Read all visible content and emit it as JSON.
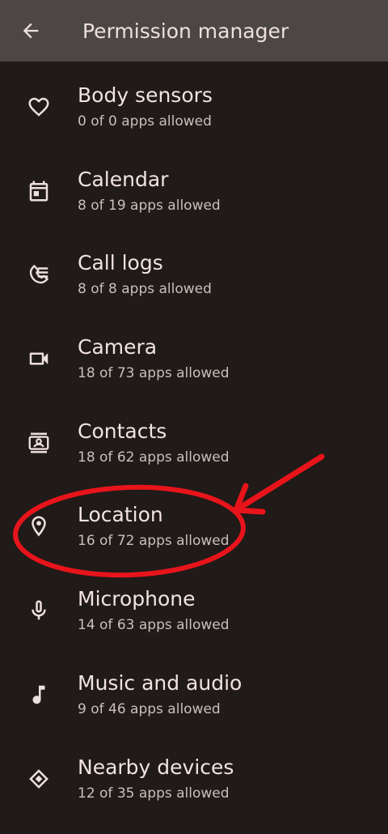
{
  "app_bar": {
    "title": "Permission manager",
    "back_icon": "arrow-back-icon"
  },
  "permissions": [
    {
      "key": "body-sensors",
      "label": "Body sensors",
      "summary": "0 of 0 apps allowed",
      "icon": "heart-icon"
    },
    {
      "key": "calendar",
      "label": "Calendar",
      "summary": "8 of 19 apps allowed",
      "icon": "calendar-icon"
    },
    {
      "key": "call-logs",
      "label": "Call logs",
      "summary": "8 of 8 apps allowed",
      "icon": "call-log-icon"
    },
    {
      "key": "camera",
      "label": "Camera",
      "summary": "18 of 73 apps allowed",
      "icon": "videocam-icon"
    },
    {
      "key": "contacts",
      "label": "Contacts",
      "summary": "18 of 62 apps allowed",
      "icon": "contacts-icon"
    },
    {
      "key": "location",
      "label": "Location",
      "summary": "16 of 72 apps allowed",
      "icon": "location-pin-icon"
    },
    {
      "key": "microphone",
      "label": "Microphone",
      "summary": "14 of 63 apps allowed",
      "icon": "microphone-icon"
    },
    {
      "key": "music-audio",
      "label": "Music and audio",
      "summary": "9 of 46 apps allowed",
      "icon": "music-note-icon"
    },
    {
      "key": "nearby-devices",
      "label": "Nearby devices",
      "summary": "12 of 35 apps allowed",
      "icon": "nearby-devices-icon"
    }
  ],
  "colors": {
    "background": "#201a18",
    "app_bar": "#4c4644",
    "text_primary": "#f1e4e0",
    "text_secondary": "#cbbfbb",
    "icon": "#ede0dc",
    "annotation": "#e8141b"
  }
}
